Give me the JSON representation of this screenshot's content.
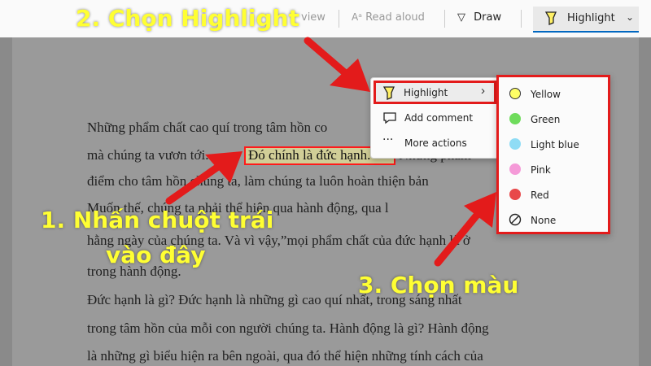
{
  "toolbar": {
    "view_label": "view",
    "read_aloud_label": "Read aloud",
    "draw_label": "Draw",
    "highlight_label": "Highlight"
  },
  "document": {
    "lines": [
      "Những phẩm chất cao quí trong tâm hồn co",
      "mà chúng ta vươn tới.",
      "điểm cho tâm hồn chúng ta, làm chúng ta luôn hoàn thiện bản",
      "Muốn thế, chúng ta phải thể hiện qua hành động, qua l",
      "hằng ngày của chúng ta. Và vì vậy,”mọi phẩm chất của đức hạnh là ở",
      "trong hành động.",
      "Đức hạnh là gì? Đức hạnh là những gì cao quí nhất, trong sáng nhất",
      "trong tâm hồn của mỗi con người chúng ta. Hành động là gì? Hành động",
      "là những gì biểu hiện ra bên ngoài, qua đó thể hiện những tính cách của"
    ],
    "selected_text": "Đó chính là đức hạnh.",
    "fragment_after": "Những phẩm"
  },
  "context_menu": {
    "items": [
      {
        "label": "Highlight",
        "icon": "highlighter-icon"
      },
      {
        "label": "Add comment",
        "icon": "comment-icon"
      },
      {
        "label": "More actions",
        "icon": "more-icon"
      }
    ]
  },
  "color_menu": {
    "items": [
      {
        "label": "Yellow",
        "color": "#ffff66"
      },
      {
        "label": "Green",
        "color": "#6fdc5c"
      },
      {
        "label": "Light blue",
        "color": "#8fdcf5"
      },
      {
        "label": "Pink",
        "color": "#f59ad8"
      },
      {
        "label": "Red",
        "color": "#e8484a"
      },
      {
        "label": "None",
        "color": "none"
      }
    ]
  },
  "annotations": {
    "step2": "2. Chọn Highlight",
    "step1_line1": "1. Nhấn chuột trái",
    "step1_line2": "vào đây",
    "step3": "3. Chọn màu"
  },
  "colors": {
    "annotation_text": "#ffff33",
    "annotation_box": "#e31b1b",
    "arrow": "#e31b1b"
  }
}
